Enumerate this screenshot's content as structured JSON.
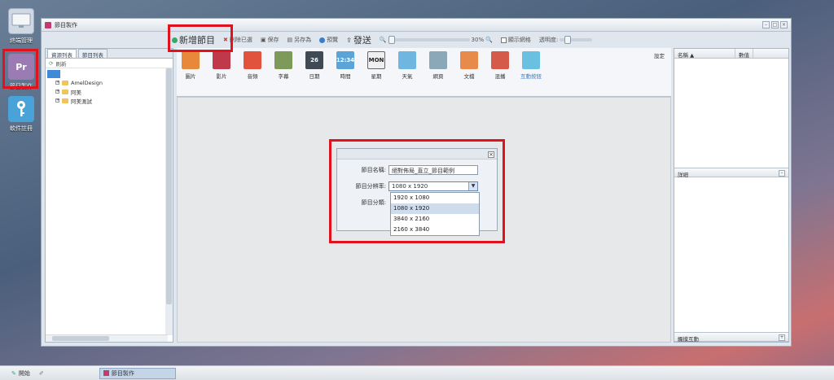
{
  "desktop": {
    "icons": [
      {
        "label": "終端管理"
      },
      {
        "label": "節目製作",
        "glyph": "Pr"
      },
      {
        "label": "軟件註冊"
      }
    ]
  },
  "window": {
    "title": "節目製作",
    "controls": {
      "minimize": "–",
      "restore": "□",
      "close": "×"
    }
  },
  "toolbar": {
    "new_program": "新增節目",
    "delete_selected": "刪除已選",
    "save": "保存",
    "save_as": "另存為",
    "preview": "預覽",
    "send": "發送",
    "zoom": "30%",
    "show_grid": "顯示網格",
    "opacity": "透明度:"
  },
  "left_panel": {
    "tabs": [
      "資源列表",
      "節目列表"
    ],
    "refresh": "刷新",
    "tree": [
      "AmelDesign",
      "阿美",
      "阿美測試"
    ]
  },
  "ribbon": {
    "items": [
      {
        "label": "圖片",
        "color": "#e8883a"
      },
      {
        "label": "影片",
        "color": "#c0394a"
      },
      {
        "label": "音頻",
        "color": "#e2533e"
      },
      {
        "label": "字幕",
        "color": "#7d9a5a"
      },
      {
        "label": "日期",
        "color": "#3f4a55",
        "glyph": "26"
      },
      {
        "label": "時間",
        "color": "#5aa4d8",
        "glyph": "12:34"
      },
      {
        "label": "星期",
        "color": "#ffffff",
        "glyph": "MON"
      },
      {
        "label": "天氣",
        "color": "#6fb7e0"
      },
      {
        "label": "網頁",
        "color": "#8aa8b8"
      },
      {
        "label": "文檔",
        "color": "#e88a4a"
      },
      {
        "label": "混播",
        "color": "#d65a4a"
      },
      {
        "label": "互動按鈕",
        "color": "#6ac0e0"
      }
    ]
  },
  "settings_label": "設定",
  "properties": {
    "col_name": "名稱 ▲",
    "col_value": "數值",
    "details": "詳細",
    "event": "觸摸互動"
  },
  "dialog": {
    "close": "×",
    "name_label": "節目名稱:",
    "name_value": "絕對佈局_直立_節目範例",
    "resolution_label": "節目分辨率:",
    "resolution_value": "1080 x 1920",
    "category_label": "節目分類:",
    "options": [
      "1920 x 1080",
      "1080 x 1920",
      "3840 x 2160",
      "2160 x 3840"
    ],
    "selected_index": 1
  },
  "taskbar": {
    "start": "開始",
    "task": "節目製作"
  }
}
